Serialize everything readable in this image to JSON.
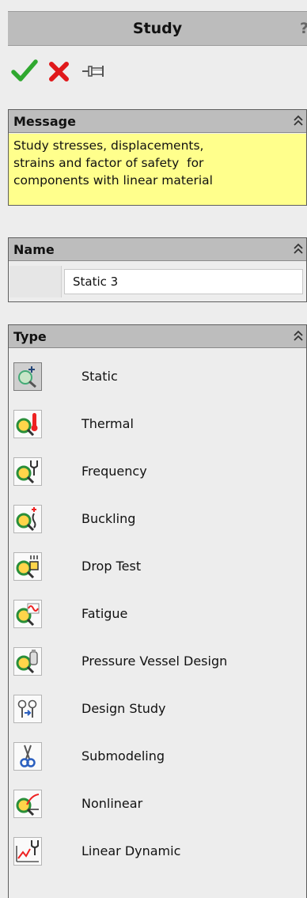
{
  "panel": {
    "title": "Study",
    "help_label": "?"
  },
  "actions": {
    "ok_icon": "checkmark-icon",
    "cancel_icon": "x-icon",
    "pin_icon": "pushpin-icon",
    "colors": {
      "ok": "#2fa82f",
      "cancel": "#e0191b"
    }
  },
  "message": {
    "header": "Message",
    "text_lines": [
      "Study stresses, displacements,",
      "strains and factor of safety  for",
      "components with linear material"
    ]
  },
  "name": {
    "header": "Name",
    "value": "Static 3"
  },
  "type": {
    "header": "Type",
    "selected": "Static",
    "items": [
      {
        "label": "Static",
        "icon": "static-study-icon"
      },
      {
        "label": "Thermal",
        "icon": "thermal-study-icon"
      },
      {
        "label": "Frequency",
        "icon": "frequency-study-icon"
      },
      {
        "label": "Buckling",
        "icon": "buckling-study-icon"
      },
      {
        "label": "Drop Test",
        "icon": "drop-test-study-icon"
      },
      {
        "label": "Fatigue",
        "icon": "fatigue-study-icon"
      },
      {
        "label": "Pressure Vessel Design",
        "icon": "pressure-vessel-study-icon"
      },
      {
        "label": "Design Study",
        "icon": "design-study-icon"
      },
      {
        "label": "Submodeling",
        "icon": "submodeling-study-icon"
      },
      {
        "label": "Nonlinear",
        "icon": "nonlinear-study-icon"
      },
      {
        "label": "Linear Dynamic",
        "icon": "linear-dynamic-study-icon"
      }
    ]
  },
  "colors": {
    "message_background": "#ffff8c",
    "header_background": "#bdbdbd"
  }
}
